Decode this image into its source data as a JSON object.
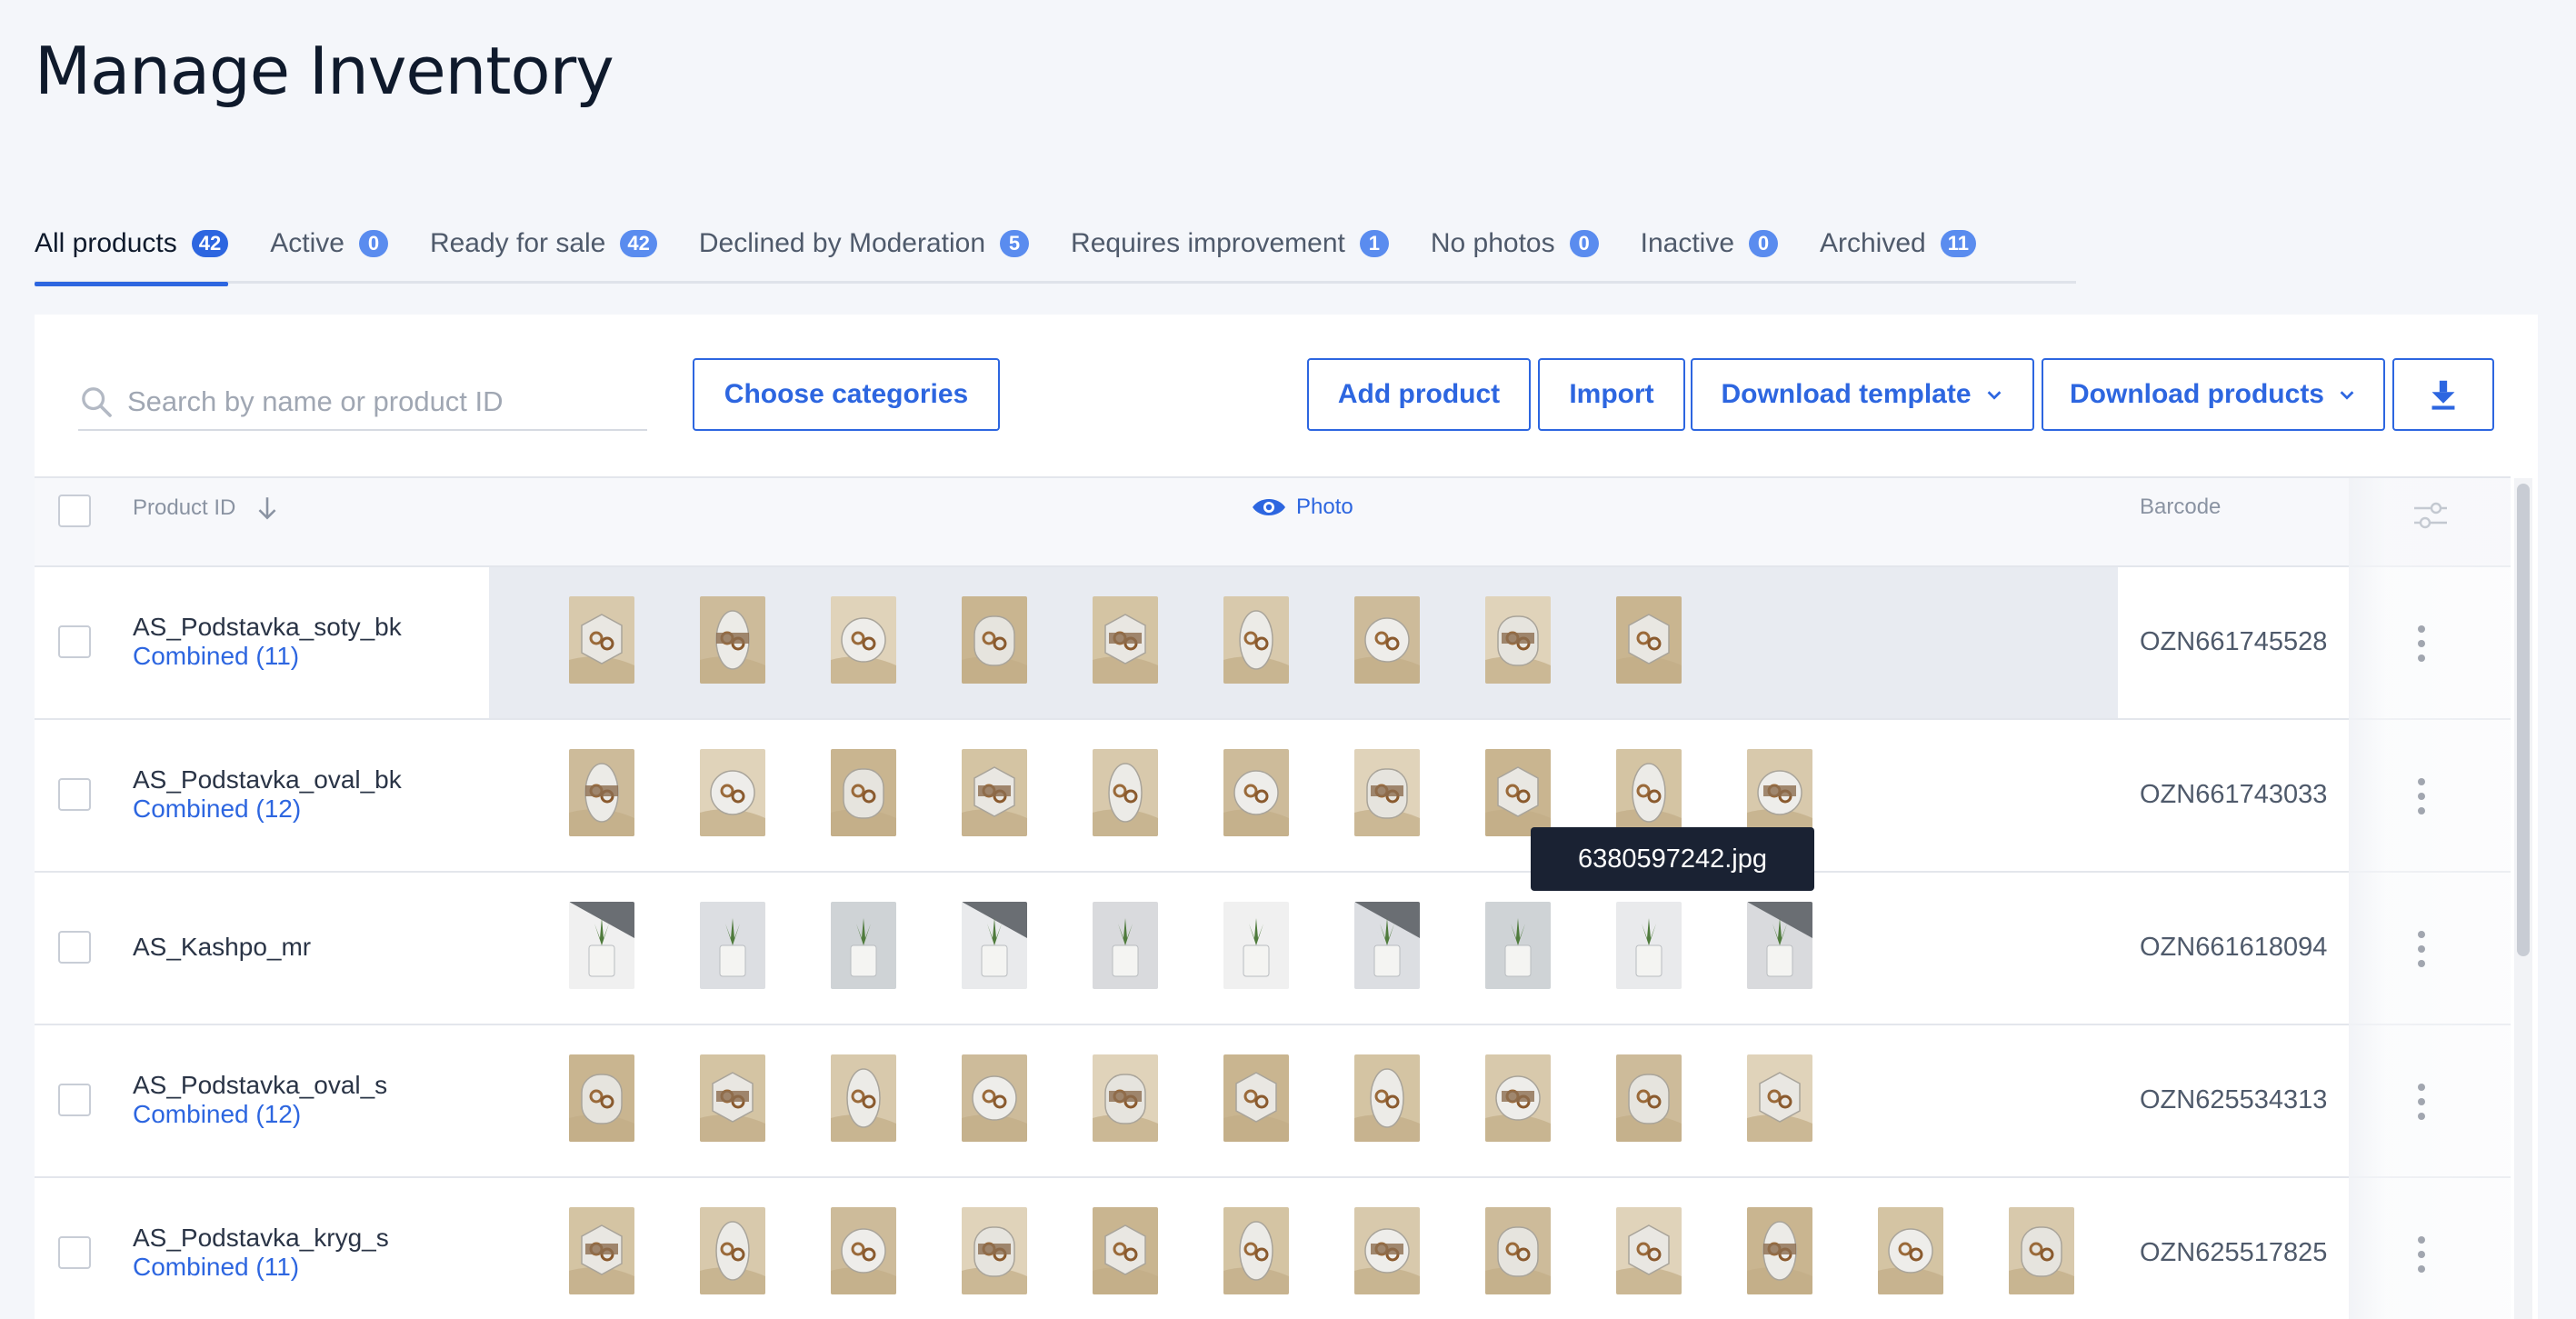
{
  "page": {
    "title": "Manage Inventory"
  },
  "tabs": [
    {
      "label": "All products",
      "count": "42",
      "active": true
    },
    {
      "label": "Active",
      "count": "0"
    },
    {
      "label": "Ready for sale",
      "count": "42"
    },
    {
      "label": "Declined by Moderation",
      "count": "5"
    },
    {
      "label": "Requires improvement",
      "count": "1"
    },
    {
      "label": "No photos",
      "count": "0"
    },
    {
      "label": "Inactive",
      "count": "0"
    },
    {
      "label": "Archived",
      "count": "11"
    }
  ],
  "toolbar": {
    "search_placeholder": "Search by name or product ID",
    "search_value": "",
    "choose_categories": "Choose categories",
    "add_product": "Add product",
    "import": "Import",
    "download_template": "Download template",
    "download_products": "Download products"
  },
  "table": {
    "headers": {
      "product_id": "Product ID",
      "photo": "Photo",
      "barcode": "Barcode"
    },
    "tooltip": "6380597242.jpg",
    "rows": [
      {
        "product_id": "AS_Podstavka_soty_bk",
        "combined": "Combined (11)",
        "barcode": "OZN661745528",
        "photo_count": 9,
        "theme": "sand"
      },
      {
        "product_id": "AS_Podstavka_oval_bk",
        "combined": "Combined (12)",
        "barcode": "OZN661743033",
        "photo_count": 10,
        "theme": "sand"
      },
      {
        "product_id": "AS_Kashpo_mr",
        "combined": "",
        "barcode": "OZN661618094",
        "photo_count": 10,
        "theme": "plant"
      },
      {
        "product_id": "AS_Podstavka_oval_s",
        "combined": "Combined (12)",
        "barcode": "OZN625534313",
        "photo_count": 10,
        "theme": "sand"
      },
      {
        "product_id": "AS_Podstavka_kryg_s",
        "combined": "Combined (11)",
        "barcode": "OZN625517825",
        "photo_count": 12,
        "theme": "sand"
      }
    ]
  },
  "colors": {
    "accent": "#2d66e0",
    "badge": "#5a8cef",
    "text": "#1b2433"
  },
  "icons": {
    "search": "search-icon",
    "sort": "arrow-down-icon",
    "photo_eye": "eye-icon",
    "columns": "sliders-icon",
    "download": "download-icon",
    "chevron": "chevron-down-icon",
    "row_menu": "kebab-icon"
  }
}
